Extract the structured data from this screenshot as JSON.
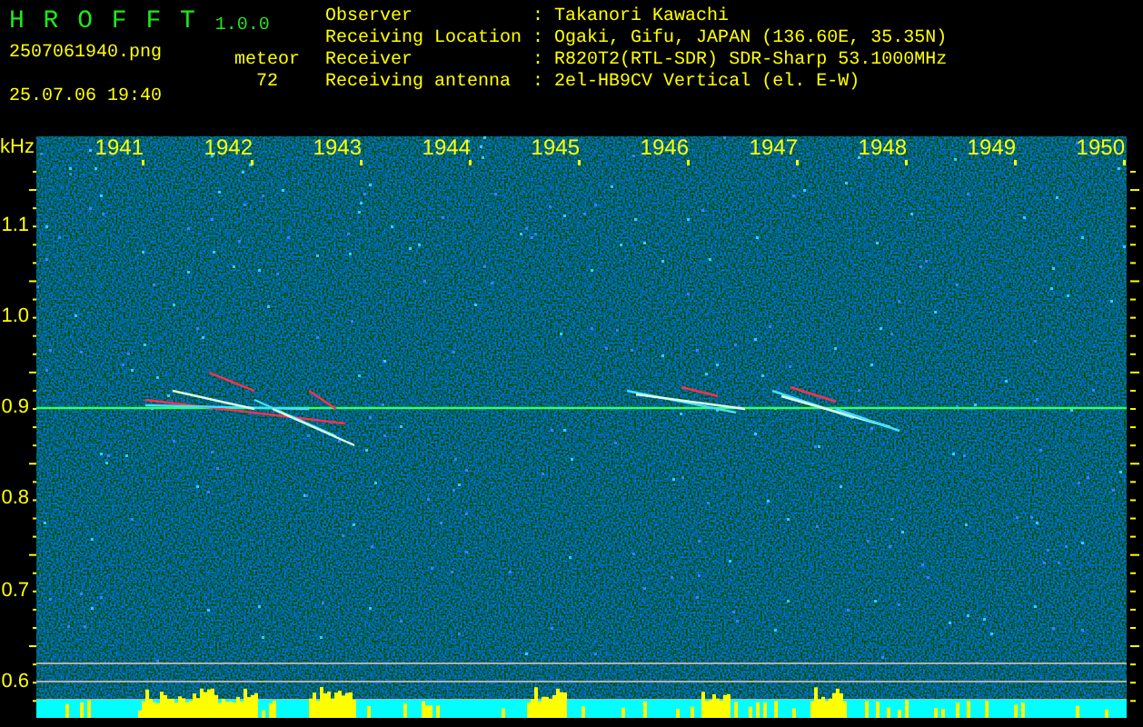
{
  "app": {
    "name": "H R O F F T",
    "version": "1.0.0"
  },
  "file": "2507061940.png",
  "datetime": "25.07.06 19:40",
  "count": {
    "label": "meteor",
    "value": "72"
  },
  "station": [
    {
      "label": "Observer",
      "separator": ":",
      "value": "Takanori Kawachi"
    },
    {
      "label": "Receiving Location",
      "separator": ":",
      "value": "Ogaki, Gifu, JAPAN (136.60E, 35.35N)"
    },
    {
      "label": "Receiver",
      "separator": ":",
      "value": "R820T2(RTL-SDR) SDR-Sharp 53.1000MHz"
    },
    {
      "label": "Receiving antenna",
      "separator": ":",
      "value": "2el-HB9CV Vertical (el. E-W)"
    }
  ],
  "spectrogram": {
    "unit": "kHz",
    "freq_labels": [
      "1.1",
      "1.0",
      "0.9",
      "0.8",
      "0.7",
      "0.6"
    ],
    "time_labels": [
      "1941",
      "1942",
      "1943",
      "1944",
      "1945",
      "1946",
      "1947",
      "1948",
      "1949",
      "1950"
    ]
  }
}
